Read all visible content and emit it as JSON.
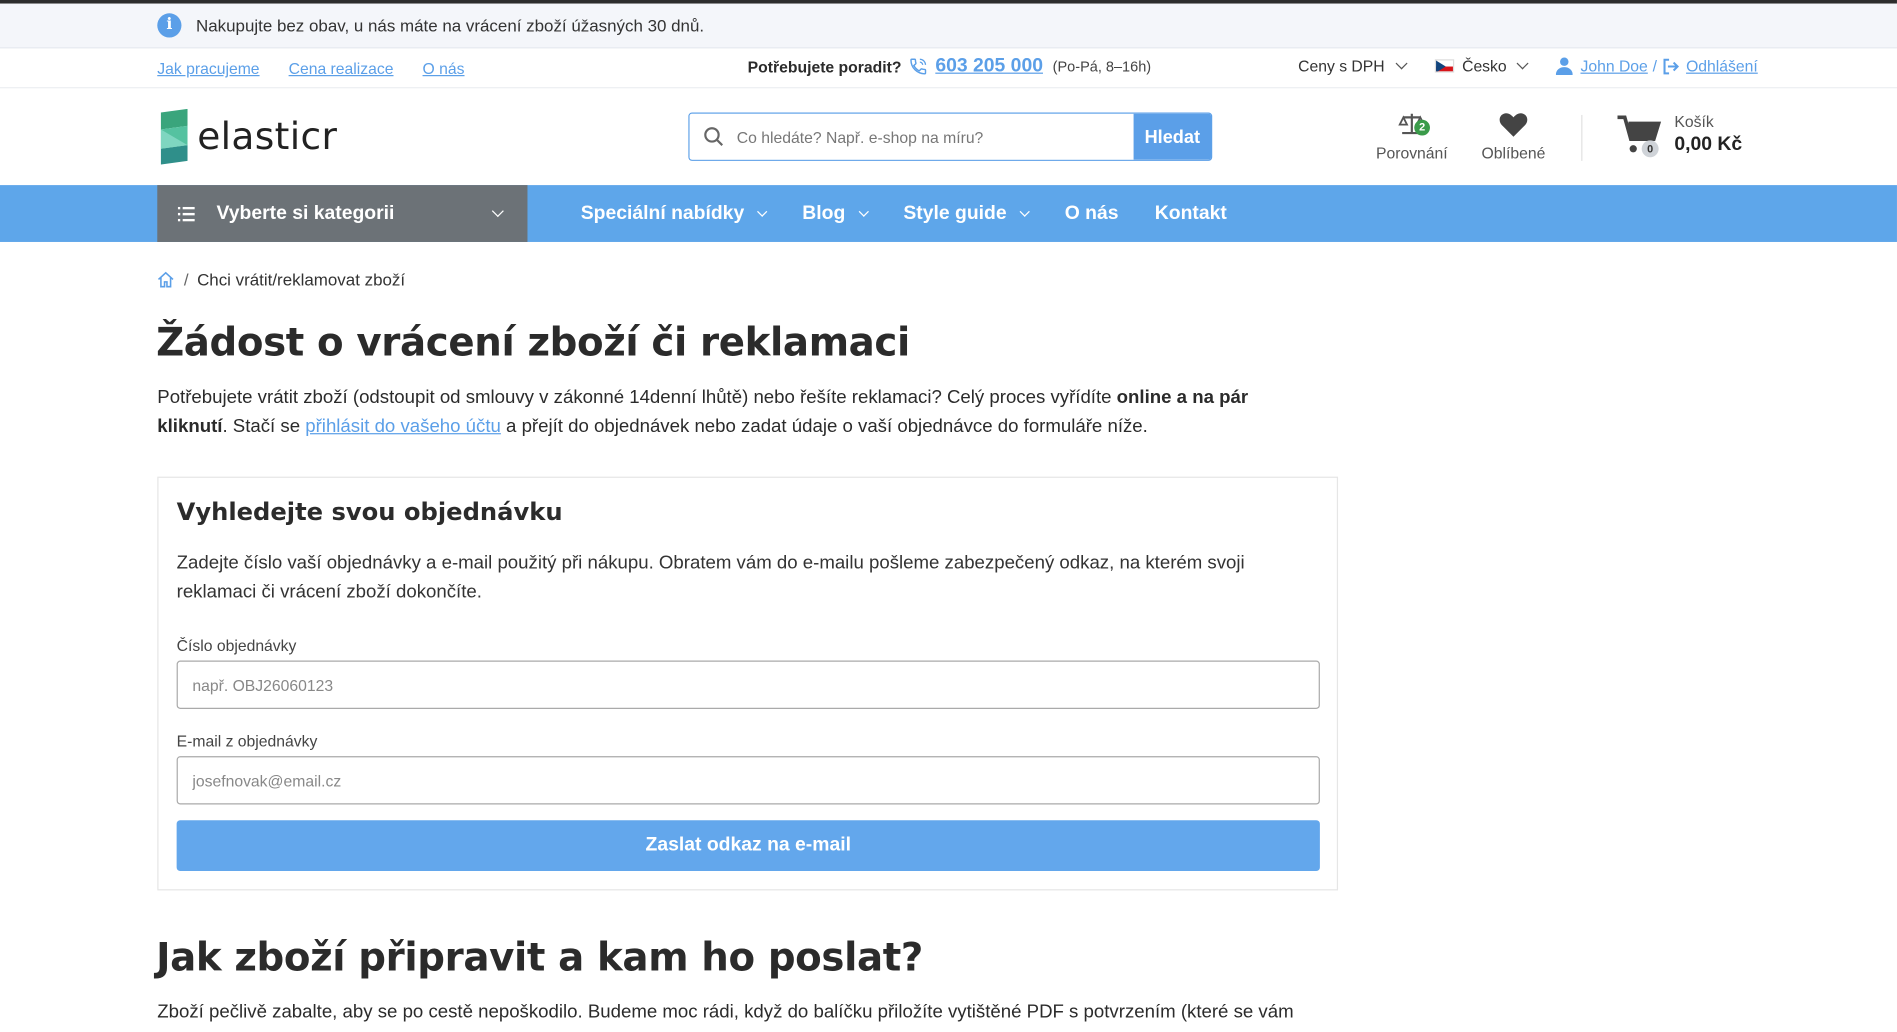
{
  "info_bar": {
    "text": "Nakupujte bez obav, u nás máte na vrácení zboží úžasných 30 dnů."
  },
  "util": {
    "links": [
      "Jak pracujeme",
      "Cena realizace",
      "O nás"
    ],
    "phone_question": "Potřebujete poradit?",
    "phone_number": "603 205 000",
    "phone_hours": "(Po-Pá, 8–16h)",
    "price_mode": "Ceny s DPH",
    "country": "Česko",
    "user_name": "John Doe",
    "logout": "Odhlášení"
  },
  "header": {
    "logo_text": "elasticr",
    "search_placeholder": "Co hledáte? Např. e-shop na míru?",
    "search_button": "Hledat",
    "compare_label": "Porovnání",
    "compare_count": "2",
    "favorites_label": "Oblíbené",
    "cart_label": "Košík",
    "cart_total": "0,00 Kč",
    "cart_count": "0"
  },
  "nav": {
    "categories_label": "Vyberte si kategorii",
    "items": [
      {
        "label": "Speciální nabídky",
        "dropdown": true
      },
      {
        "label": "Blog",
        "dropdown": true
      },
      {
        "label": "Style guide",
        "dropdown": true
      },
      {
        "label": "O nás",
        "dropdown": false
      },
      {
        "label": "Kontakt",
        "dropdown": false
      }
    ]
  },
  "breadcrumb": {
    "current": "Chci vrátit/reklamovat zboží"
  },
  "main": {
    "title": "Žádost o vrácení zboží či reklamaci",
    "intro_1": "Potřebujete vrátit zboží (odstoupit od smlouvy v zákonné 14denní lhůtě) nebo řešíte reklamaci? Celý proces vyřídíte ",
    "intro_bold": "online a na pár kliknutí",
    "intro_2": ". Stačí se ",
    "intro_link": "přihlásit do vašeho účtu",
    "intro_3": " a přejít do objednávek nebo zadat údaje o vaší objednávce do formuláře níže."
  },
  "form": {
    "heading": "Vyhledejte svou objednávku",
    "description": "Zadejte číslo vaší objednávky a e-mail použitý při nákupu. Obratem vám do e-mailu pošleme zabezpečený odkaz, na kterém svoji reklamaci či vrácení zboží dokončíte.",
    "order_label": "Číslo objednávky",
    "order_placeholder": "např. OBJ26060123",
    "email_label": "E-mail z objednávky",
    "email_placeholder": "josefnovak@email.cz",
    "submit_label": "Zaslat odkaz na e-mail"
  },
  "section2": {
    "title": "Jak zboží připravit a kam ho poslat?",
    "text": "Zboží pečlivě zabalte, aby se po cestě nepoškodilo. Budeme moc rádi, když do balíčku přiložíte vytištěné PDF s potvrzením (které se vám"
  },
  "colors": {
    "accent": "#5b9fe8",
    "nav_bg": "#5ea6ea",
    "category_bg": "#6c7277",
    "badge_green": "#3a9b4a"
  }
}
